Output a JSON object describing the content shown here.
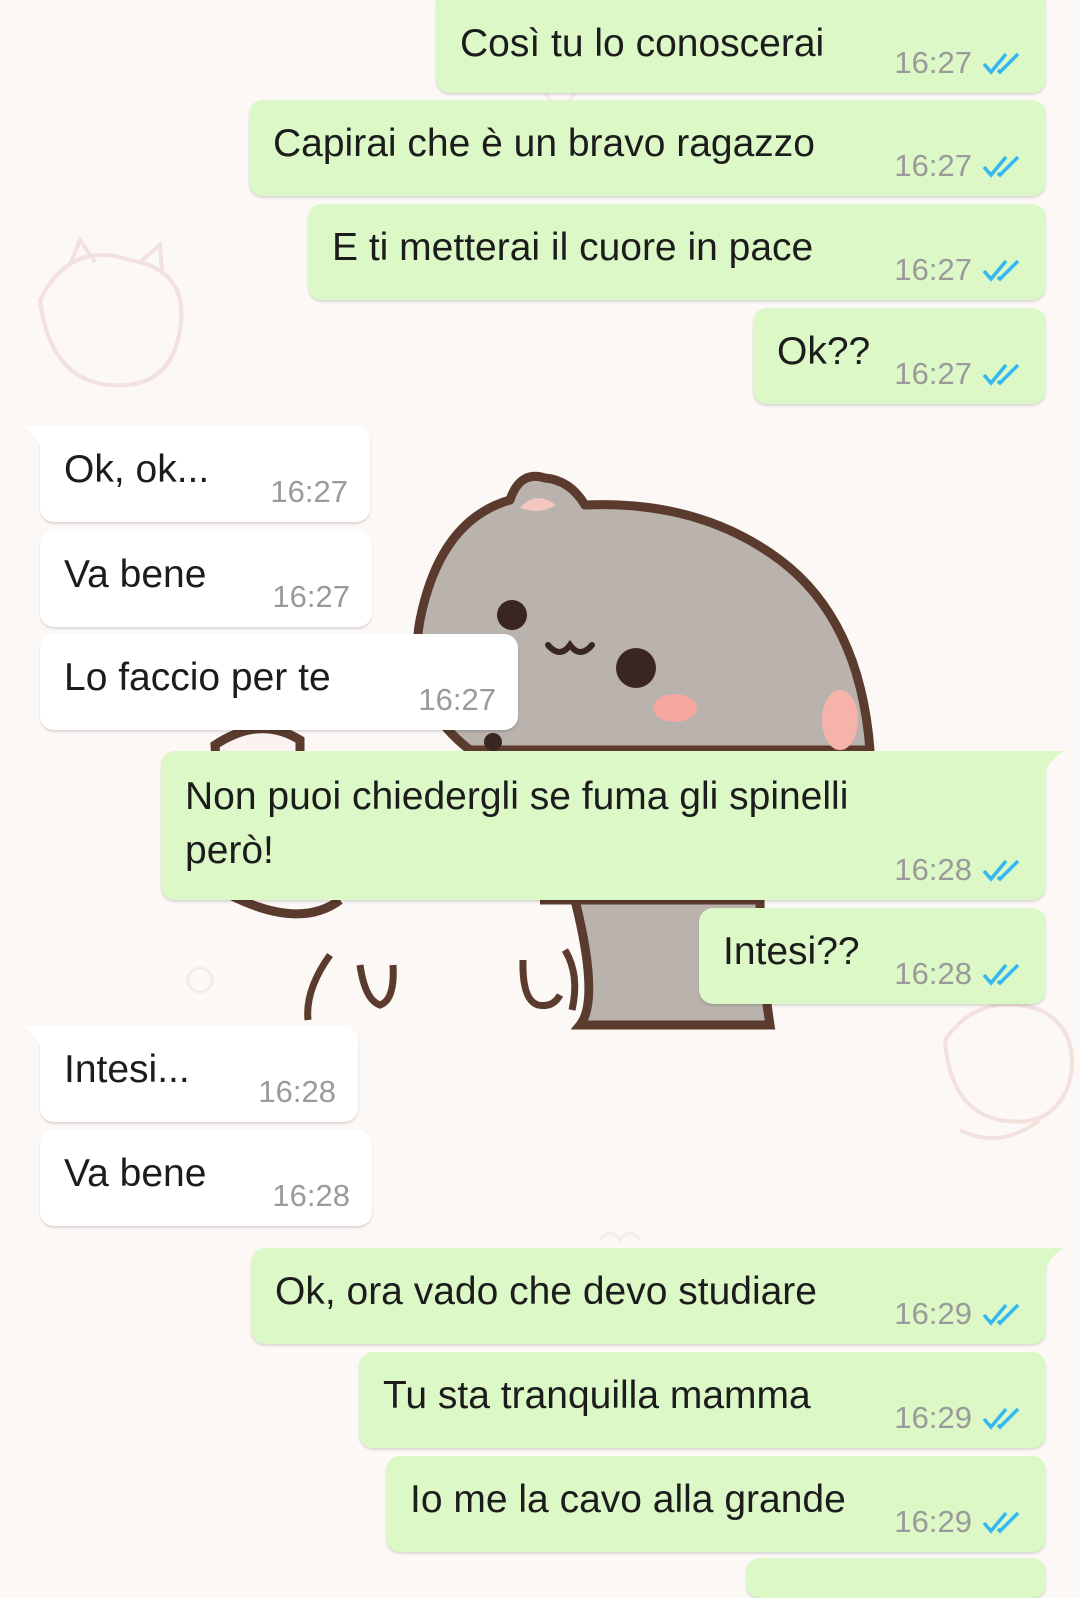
{
  "colors": {
    "outgoing_bubble": "#dcf8c6",
    "incoming_bubble": "#ffffff",
    "read_tick": "#34b7f1",
    "timestamp": "#9a9a9a"
  },
  "icons": {
    "read_receipt": "double-check-icon"
  },
  "sticker": {
    "name": "grey-cat-sticker"
  },
  "messages": [
    {
      "dir": "out",
      "text": "Così tu lo conoscerai",
      "time": "16:27",
      "status": "read"
    },
    {
      "dir": "out",
      "text": "Capirai che è un bravo ragazzo",
      "time": "16:27",
      "status": "read"
    },
    {
      "dir": "out",
      "text": "E ti metterai il cuore in pace",
      "time": "16:27",
      "status": "read"
    },
    {
      "dir": "out",
      "text": "Ok??",
      "time": "16:27",
      "status": "read"
    },
    {
      "dir": "in",
      "text": "Ok, ok...",
      "time": "16:27"
    },
    {
      "dir": "in",
      "text": "Va bene",
      "time": "16:27"
    },
    {
      "dir": "in",
      "text": "Lo faccio per te",
      "time": "16:27"
    },
    {
      "dir": "out",
      "text_lines": [
        "Non puoi chiedergli se fuma gli spinelli",
        "però!"
      ],
      "time": "16:28",
      "status": "read"
    },
    {
      "dir": "out",
      "text": "Intesi??",
      "time": "16:28",
      "status": "read"
    },
    {
      "dir": "in",
      "text": "Intesi...",
      "time": "16:28"
    },
    {
      "dir": "in",
      "text": "Va bene",
      "time": "16:28"
    },
    {
      "dir": "out",
      "text": "Ok, ora vado che devo studiare",
      "time": "16:29",
      "status": "read"
    },
    {
      "dir": "out",
      "text": "Tu sta tranquilla mamma",
      "time": "16:29",
      "status": "read"
    },
    {
      "dir": "out",
      "text": "Io me la cavo alla grande",
      "time": "16:29",
      "status": "read"
    }
  ]
}
